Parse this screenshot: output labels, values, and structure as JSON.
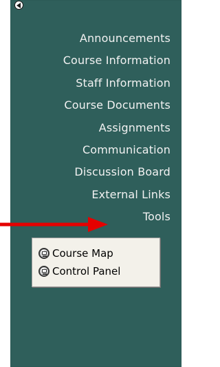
{
  "menu": {
    "items": [
      {
        "label": "Announcements"
      },
      {
        "label": "Course Information"
      },
      {
        "label": "Staff Information"
      },
      {
        "label": "Course Documents"
      },
      {
        "label": "Assignments"
      },
      {
        "label": "Communication"
      },
      {
        "label": "Discussion Board"
      },
      {
        "label": "External Links"
      },
      {
        "label": "Tools"
      }
    ]
  },
  "submenu": {
    "items": [
      {
        "label": "Course Map",
        "icon": "course-map-icon"
      },
      {
        "label": "Control Panel",
        "icon": "control-panel-icon"
      }
    ]
  },
  "colors": {
    "panel": "#2f5f5b",
    "menu_text": "#f2f2f2",
    "arrow": "#e50000",
    "submenu_background": "#f3f1ea"
  }
}
